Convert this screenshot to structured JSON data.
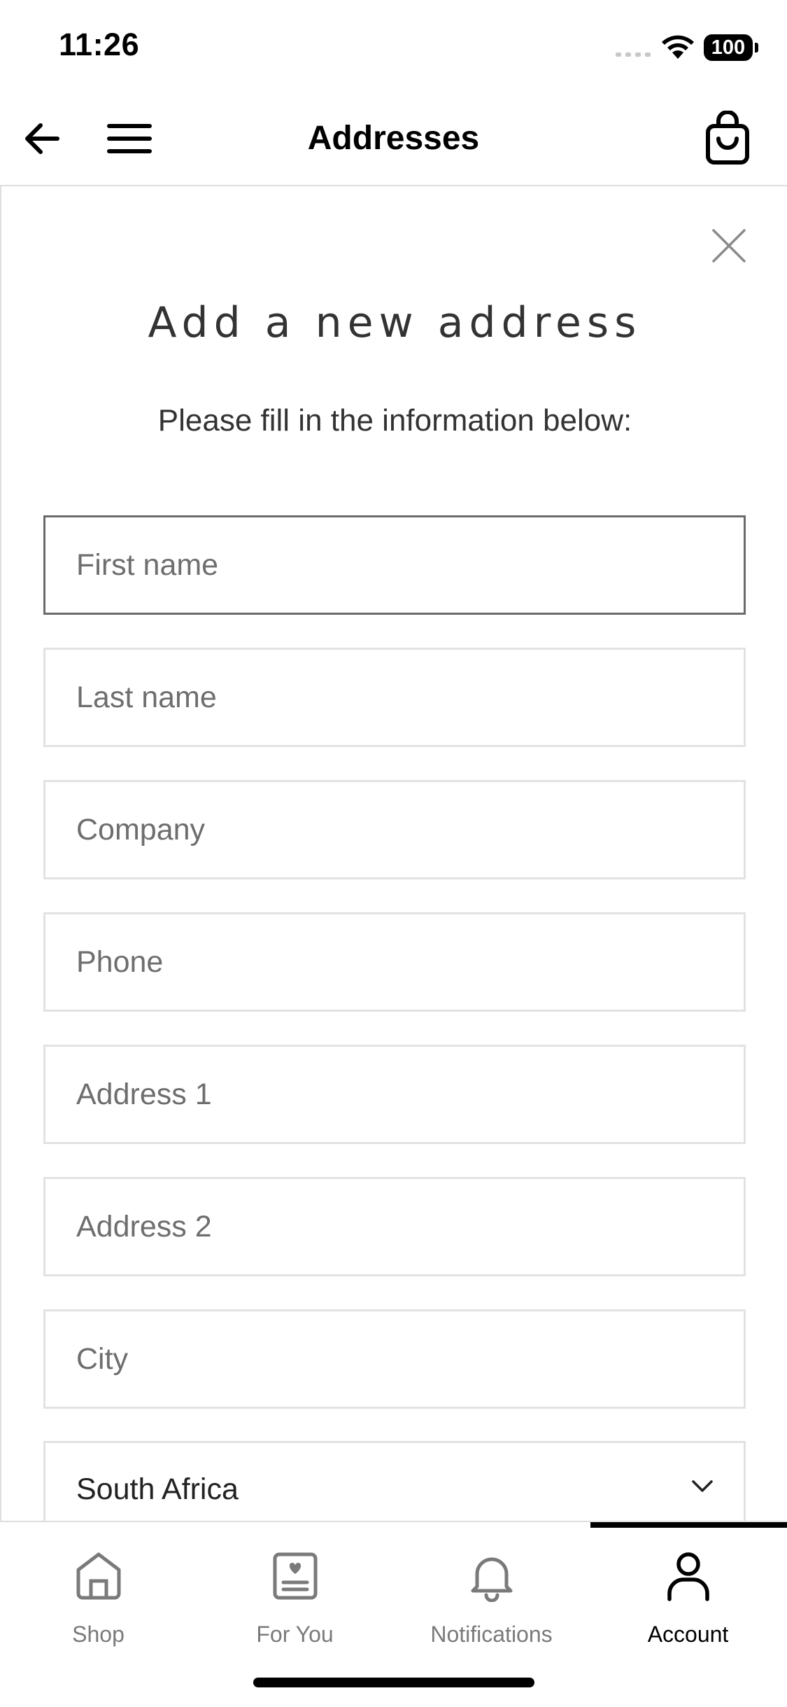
{
  "status_bar": {
    "time": "11:26",
    "battery": "100"
  },
  "header": {
    "title": "Addresses"
  },
  "form": {
    "title": "Add a new address",
    "subtitle": "Please fill in the information below:",
    "fields": {
      "first_name": "First name",
      "last_name": "Last name",
      "company": "Company",
      "phone": "Phone",
      "address1": "Address 1",
      "address2": "Address 2",
      "city": "City"
    },
    "country": "South Africa"
  },
  "tabs": {
    "shop": "Shop",
    "for_you": "For You",
    "notifications": "Notifications",
    "account": "Account"
  }
}
